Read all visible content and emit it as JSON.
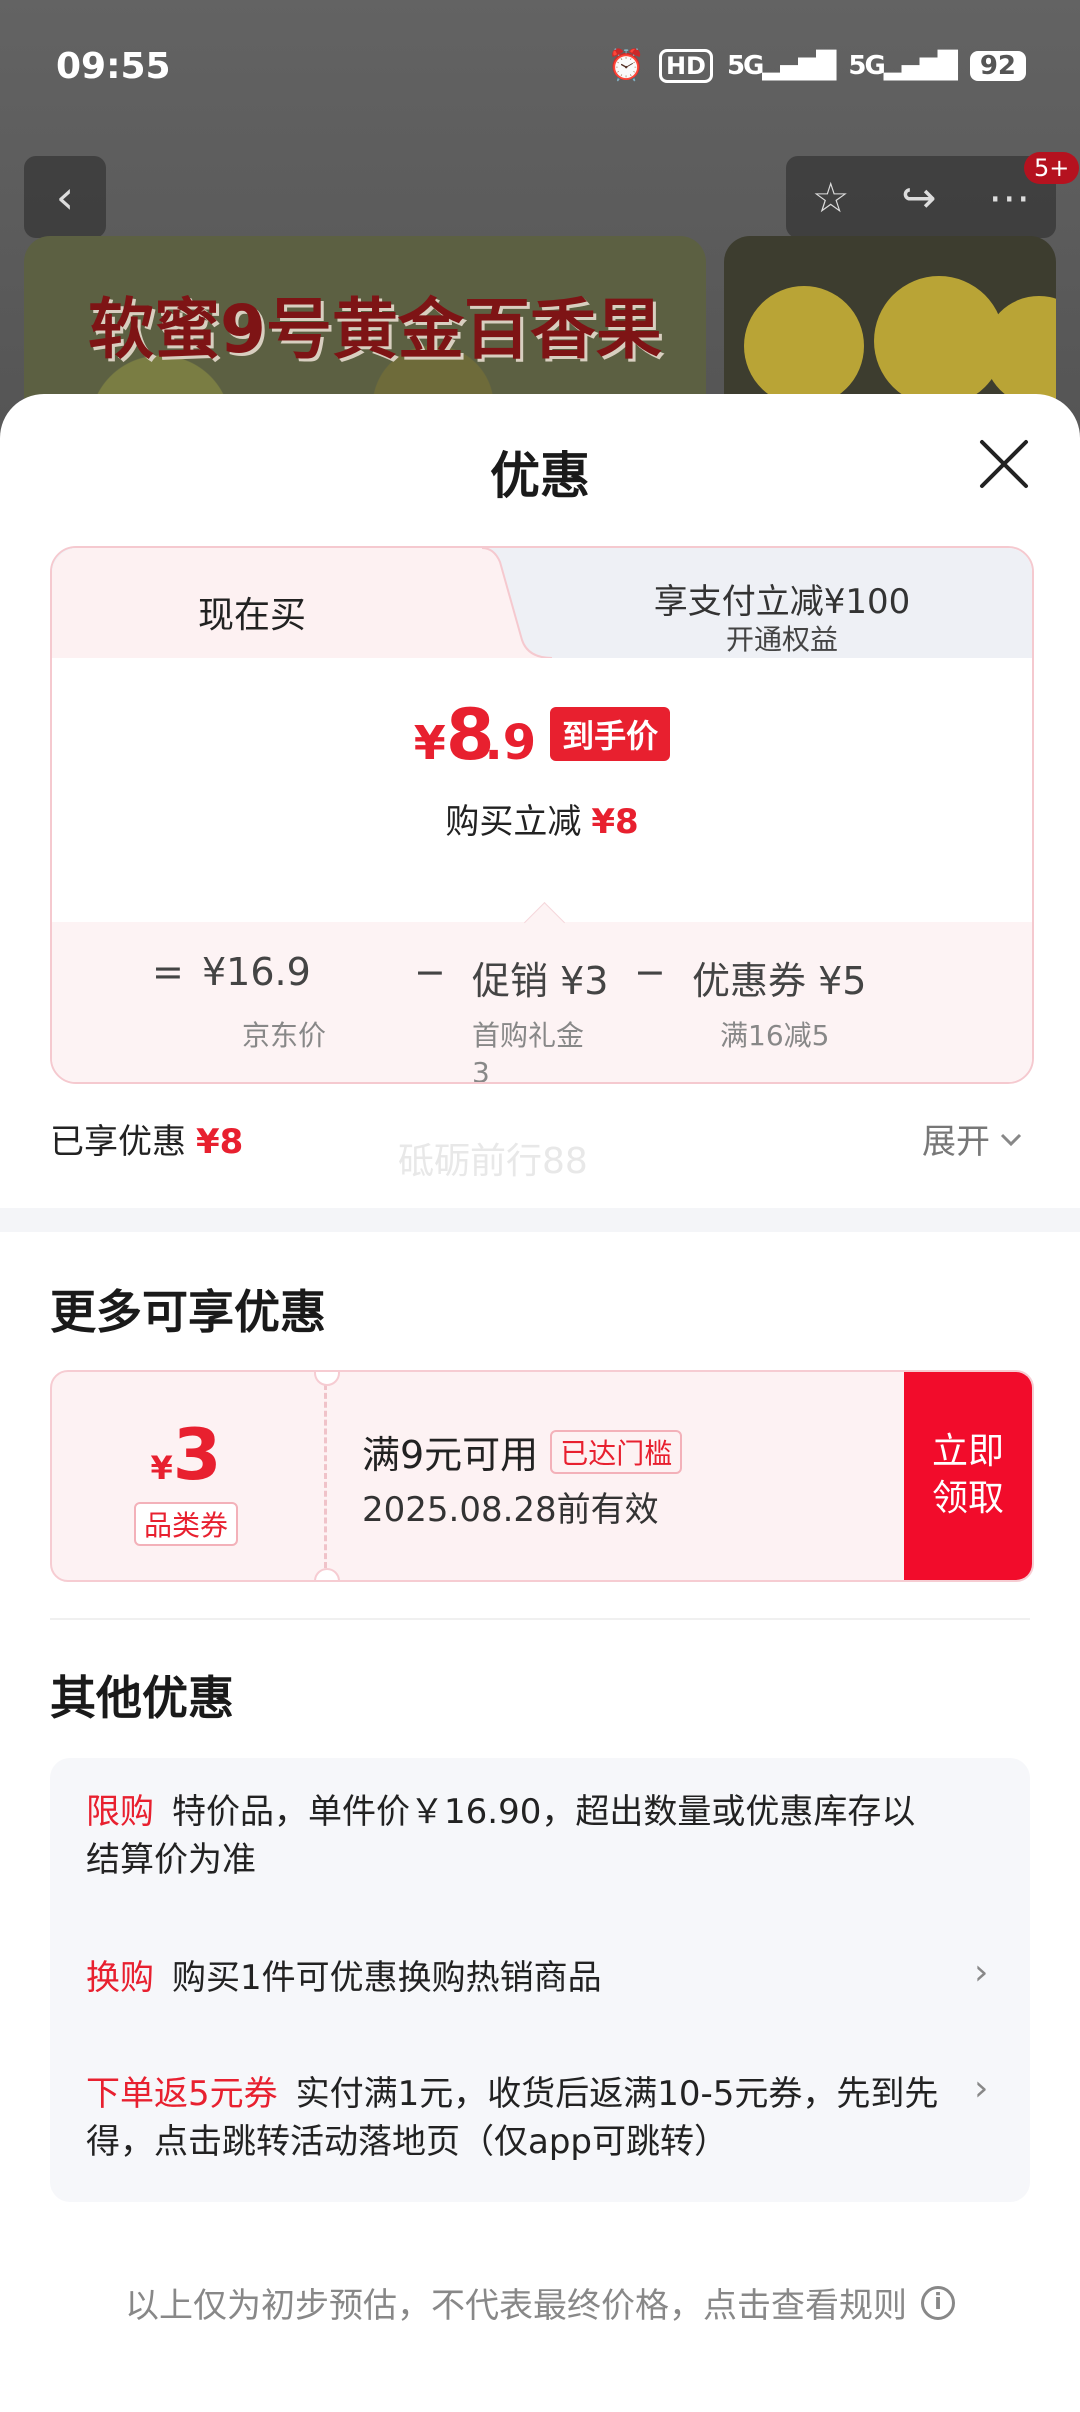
{
  "status_bar": {
    "time": "09:55",
    "hd": "HD",
    "net1": "5G",
    "net2": "5G",
    "battery": "92"
  },
  "nav": {
    "back_icon": "chevron-left-icon",
    "badge": "5+"
  },
  "banner": {
    "title": "软蜜9号黄金百香果"
  },
  "sheet": {
    "title": "优惠",
    "close_icon": "close-icon"
  },
  "price_card": {
    "tab_now": "现在买",
    "tab_pay_line1": "享支付立减¥100",
    "tab_pay_line2": "开通权益",
    "yen": "¥",
    "price_int": "8",
    "price_dec": ".9",
    "final_tag": "到手价",
    "saving_label": "购买立减",
    "saving_value": "¥8",
    "breakdown": {
      "eq": "=",
      "jd_price": "¥16.9",
      "jd_price_label": "京东价",
      "minus1": "−",
      "promo": "促销 ¥3",
      "promo_label_1": "首购礼金",
      "promo_label_2": "3",
      "minus2": "−",
      "coupon": "优惠券 ¥5",
      "coupon_label": "满16减5"
    }
  },
  "enjoyed": {
    "label": "已享优惠",
    "value": "¥8",
    "watermark": "砥砺前行88",
    "expand": "展开"
  },
  "more_offers": {
    "title": "更多可享优惠",
    "coupon": {
      "yen": "¥",
      "amount": "3",
      "type": "品类券",
      "condition": "满9元可用",
      "reached": "已达门槛",
      "valid": "2025.08.28前有效",
      "btn_line1": "立即",
      "btn_line2": "领取"
    }
  },
  "other_offers": {
    "title": "其他优惠",
    "items": [
      {
        "label": "限购",
        "text": "特价品，单件价￥16.90，超出数量或优惠库存以结算价为准"
      },
      {
        "label": "换购",
        "text": "购买1件可优惠换购热销商品"
      },
      {
        "label": "下单返5元券",
        "text": "实付满1元，收货后返满10-5元券，先到先得，点击跳转活动落地页（仅app可跳转）"
      }
    ]
  },
  "footer": {
    "text": "以上仅为初步预估，不代表最终价格，点击查看规则",
    "icon": "info-icon",
    "icon_glyph": "i"
  },
  "colors": {
    "accent": "#e8202f",
    "button_red": "#f20c2b"
  }
}
